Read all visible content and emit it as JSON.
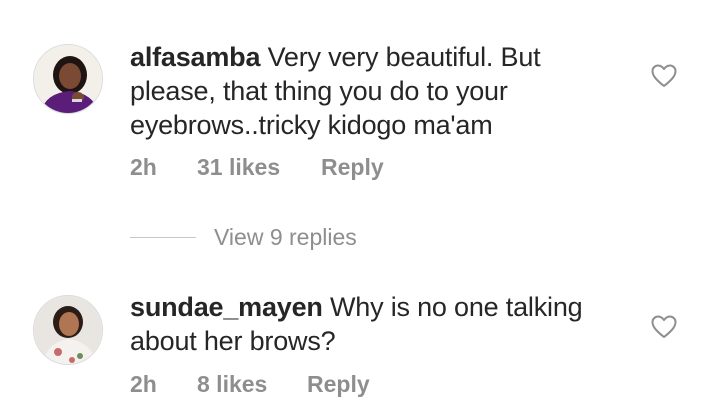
{
  "comments": [
    {
      "username": "alfasamba",
      "text": "Very very beautiful. But please, that thing you do to your eyebrows..tricky kidogo ma'am",
      "time": "2h",
      "likes": "31 likes",
      "reply_label": "Reply",
      "icons": {
        "like": "heart-outline-icon"
      }
    },
    {
      "username": "sundae_mayen",
      "text": "Why is no one talking about her brows?",
      "time": "2h",
      "likes": "8 likes",
      "reply_label": "Reply",
      "icons": {
        "like": "heart-outline-icon"
      }
    }
  ],
  "view_replies_label": "View 9 replies",
  "colors": {
    "text": "#262626",
    "muted": "#8e8e8e",
    "divider": "#c7c7c7"
  }
}
